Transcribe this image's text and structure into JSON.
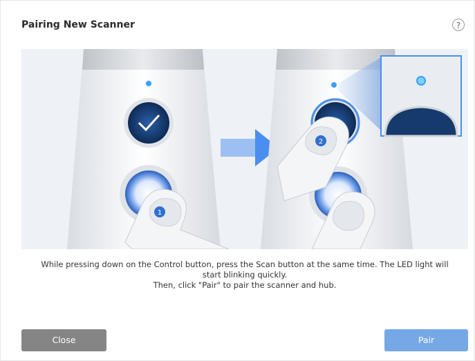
{
  "dialog": {
    "title": "Pairing New Scanner",
    "help_glyph": "?",
    "description_lines": [
      "While pressing down on the Control button, press the Scan button at the same time. The LED light will",
      "start blinking quickly.",
      "Then, click \"Pair\" to pair the scanner and hub."
    ],
    "close_label": "Close",
    "pair_label": "Pair"
  },
  "illustration": {
    "step_badges": [
      "1",
      "2"
    ],
    "icons": [
      "check-icon",
      "arrow-right-icon",
      "led-indicator-icon",
      "finger-icon"
    ],
    "colors": {
      "accent": "#2f6fd0",
      "arrow": "#4a8ef0",
      "led": "#3aa0ff",
      "button_dark": "#163a6b",
      "close_button": "#858585",
      "pair_button": "#76a8e6"
    }
  }
}
